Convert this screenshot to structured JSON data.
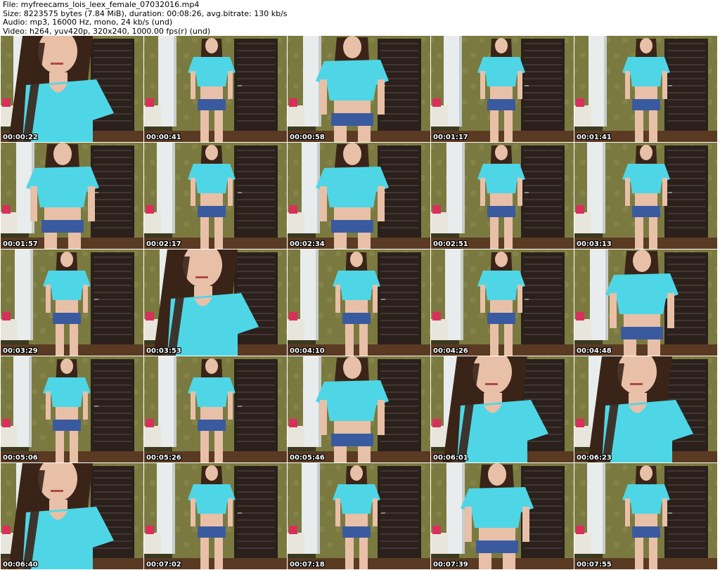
{
  "header": {
    "file_line": "File: myfreecams_lois_leex_female_07032016.mp4",
    "size_line": "Size: 8223575 bytes (7.84 MiB), duration: 00:08:26, avg.bitrate: 130 kb/s",
    "audio_line": "Audio: mp3, 16000 Hz, mono, 24 kb/s (und)",
    "video_line": "Video: h264, yuv420p, 320x240, 1000.00 fps(r) (und)"
  },
  "colors": {
    "wallpaper": "#7a7a40",
    "door": "#2a201c",
    "shirt": "#4fd6e6",
    "shorts": "#3a5aa0",
    "skin": "#e8c0a8",
    "hair": "#3a2418",
    "floor": "#5a3a22",
    "pillar": "#e8ecec",
    "sofa_pillow": "#d8305a"
  },
  "thumbnails": [
    {
      "timestamp": "00:00:22",
      "scene": "closeup"
    },
    {
      "timestamp": "00:00:41",
      "scene": "full"
    },
    {
      "timestamp": "00:00:58",
      "scene": "mid"
    },
    {
      "timestamp": "00:01:17",
      "scene": "full"
    },
    {
      "timestamp": "00:01:41",
      "scene": "full"
    },
    {
      "timestamp": "00:01:57",
      "scene": "mid"
    },
    {
      "timestamp": "00:02:17",
      "scene": "full"
    },
    {
      "timestamp": "00:02:34",
      "scene": "mid"
    },
    {
      "timestamp": "00:02:51",
      "scene": "full"
    },
    {
      "timestamp": "00:03:13",
      "scene": "full"
    },
    {
      "timestamp": "00:03:29",
      "scene": "full"
    },
    {
      "timestamp": "00:03:53",
      "scene": "closeup"
    },
    {
      "timestamp": "00:04:10",
      "scene": "full"
    },
    {
      "timestamp": "00:04:26",
      "scene": "full"
    },
    {
      "timestamp": "00:04:48",
      "scene": "mid"
    },
    {
      "timestamp": "00:05:06",
      "scene": "full"
    },
    {
      "timestamp": "00:05:26",
      "scene": "full"
    },
    {
      "timestamp": "00:05:46",
      "scene": "mid"
    },
    {
      "timestamp": "00:06:01",
      "scene": "closeup"
    },
    {
      "timestamp": "00:06:23",
      "scene": "closeup"
    },
    {
      "timestamp": "00:06:40",
      "scene": "closeup"
    },
    {
      "timestamp": "00:07:02",
      "scene": "full"
    },
    {
      "timestamp": "00:07:18",
      "scene": "full"
    },
    {
      "timestamp": "00:07:39",
      "scene": "mid"
    },
    {
      "timestamp": "00:07:55",
      "scene": "full"
    }
  ]
}
